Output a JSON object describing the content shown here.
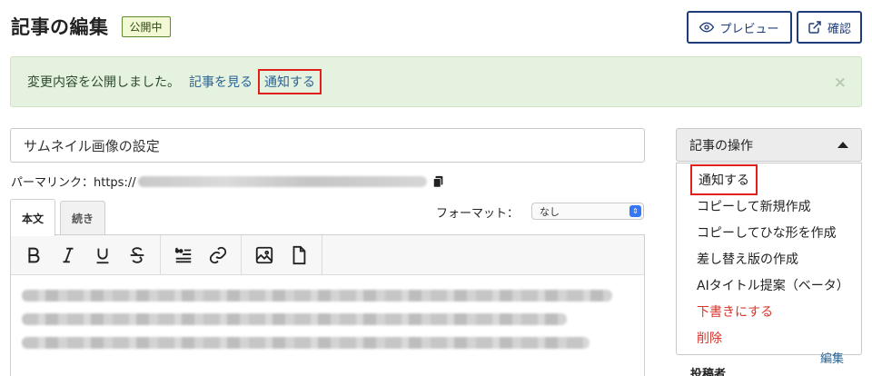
{
  "header": {
    "title": "記事の編集",
    "status_badge": "公開中",
    "preview_label": "プレビュー",
    "confirm_label": "確認"
  },
  "notice": {
    "message": "変更内容を公開しました。",
    "view_link": "記事を見る",
    "notify_link": "通知する",
    "close": "×"
  },
  "editor": {
    "title_value": "サムネイル画像の設定",
    "permalink_label": "パーマリンク：https://",
    "tabs": [
      {
        "label": "本文"
      },
      {
        "label": "続き"
      }
    ],
    "format_label": "フォーマット：",
    "format_selected": "なし",
    "toolbar_icons": [
      "bold-icon",
      "italic-icon",
      "underline-icon",
      "strikethrough-icon",
      "blockquote-icon",
      "link-icon",
      "image-icon",
      "file-icon"
    ]
  },
  "operations": {
    "header": "記事の操作",
    "items": [
      {
        "label": "通知する"
      },
      {
        "label": "コピーして新規作成"
      },
      {
        "label": "コピーしてひな形を作成"
      },
      {
        "label": "差し替え版の作成"
      },
      {
        "label": "AIタイトル提案（ベータ）"
      },
      {
        "label": "下書きにする"
      },
      {
        "label": "削除"
      }
    ]
  },
  "sidebar": {
    "edit_link": "編集",
    "author_label": "投稿者"
  },
  "colors": {
    "accent": "#1f3c7a",
    "link": "#2a6496",
    "danger": "#d9352b",
    "highlight": "#e0201b",
    "notice_bg": "#e5f2df"
  }
}
